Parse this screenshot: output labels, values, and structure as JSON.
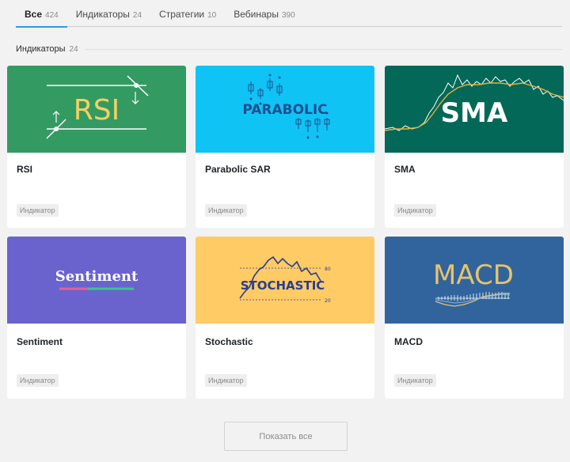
{
  "tabs": [
    {
      "label": "Все",
      "count": "424",
      "active": true
    },
    {
      "label": "Индикаторы",
      "count": "24",
      "active": false
    },
    {
      "label": "Стратегии",
      "count": "10",
      "active": false
    },
    {
      "label": "Вебинары",
      "count": "390",
      "active": false
    }
  ],
  "section": {
    "title": "Индикаторы",
    "count": "24"
  },
  "cards": [
    {
      "title": "RSI",
      "tag": "Индикатор",
      "banner_text": "RSI",
      "banner_color": "#339b62"
    },
    {
      "title": "Parabolic SAR",
      "tag": "Индикатор",
      "banner_text": "PARABOLIC",
      "banner_color": "#10c3f5"
    },
    {
      "title": "SMA",
      "tag": "Индикатор",
      "banner_text": "SMA",
      "banner_color": "#046858"
    },
    {
      "title": "Sentiment",
      "tag": "Индикатор",
      "banner_text": "Sentiment",
      "banner_color": "#6a63ce"
    },
    {
      "title": "Stochastic",
      "tag": "Индикатор",
      "banner_text": "STOCHASTIC",
      "banner_color": "#fecb65"
    },
    {
      "title": "MACD",
      "tag": "Индикатор",
      "banner_text": "MACD",
      "banner_color": "#31649c"
    }
  ],
  "show_all_label": "Показать все"
}
